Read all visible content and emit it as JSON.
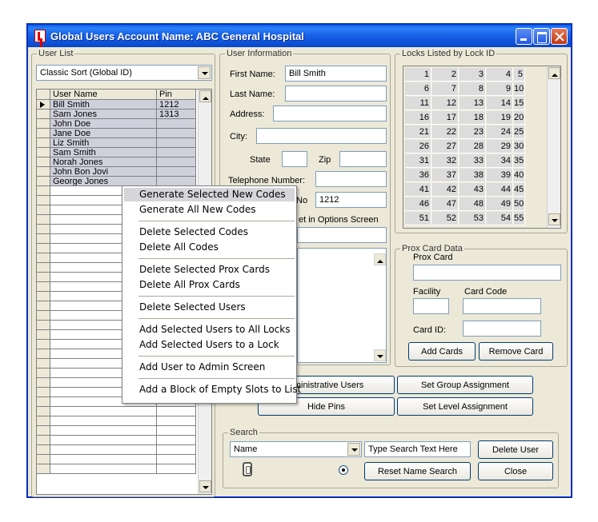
{
  "window": {
    "title": "Global Users Account Name: ABC General Hospital"
  },
  "user_list": {
    "group_label": "User List",
    "sort_select": "Classic Sort (Global ID)",
    "columns": [
      "User Name",
      "Pin"
    ],
    "rows": [
      {
        "name": "Bill Smith",
        "pin": "1212"
      },
      {
        "name": "Sam Jones",
        "pin": "1313"
      },
      {
        "name": "John Doe",
        "pin": ""
      },
      {
        "name": "Jane Doe",
        "pin": ""
      },
      {
        "name": "Liz Smith",
        "pin": ""
      },
      {
        "name": "Sam Smith",
        "pin": ""
      },
      {
        "name": "Norah Jones",
        "pin": ""
      },
      {
        "name": "John Bon Jovi",
        "pin": ""
      },
      {
        "name": "George Jones",
        "pin": ""
      }
    ]
  },
  "user_info": {
    "group_label": "User Information",
    "first_name_label": "First Name:",
    "first_name_value": "Bill Smith",
    "last_name_label": "Last Name:",
    "address_label": "Address:",
    "city_label": "City:",
    "state_label": "State",
    "zip_label": "Zip",
    "telephone_label": "Telephone Number:",
    "pin_partial_label": "No",
    "pin_value": "1212",
    "options_partial": "et in Options Screen"
  },
  "locks": {
    "group_label": "Locks Listed by Lock ID",
    "rows": [
      [
        "1",
        "2",
        "3",
        "4",
        "5"
      ],
      [
        "6",
        "7",
        "8",
        "9",
        "10"
      ],
      [
        "11",
        "12",
        "13",
        "14",
        "15"
      ],
      [
        "16",
        "17",
        "18",
        "19",
        "20"
      ],
      [
        "21",
        "22",
        "23",
        "24",
        "25"
      ],
      [
        "26",
        "27",
        "28",
        "29",
        "30"
      ],
      [
        "31",
        "32",
        "33",
        "34",
        "35"
      ],
      [
        "36",
        "37",
        "38",
        "39",
        "40"
      ],
      [
        "41",
        "42",
        "43",
        "44",
        "45"
      ],
      [
        "46",
        "47",
        "48",
        "49",
        "50"
      ],
      [
        "51",
        "52",
        "53",
        "54",
        "55"
      ]
    ]
  },
  "prox": {
    "group_label": "Prox Card Data",
    "prox_card_label": "Prox Card",
    "facility_label": "Facility",
    "card_code_label": "Card Code",
    "card_id_label": "Card ID:",
    "add_cards": "Add Cards",
    "remove_card": "Remove Card"
  },
  "buttons": {
    "admin_users_partial": "dministrative Users",
    "set_group": "Set Group Assignment",
    "hide_pins": "Hide Pins",
    "set_level": "Set Level Assignment",
    "delete_user": "Delete User",
    "close": "Close"
  },
  "search": {
    "group_label": "Search",
    "field_select": "Name",
    "text_value": "Type Search Text Here",
    "reset": "Reset Name Search"
  },
  "context_menu": {
    "items": [
      "Generate Selected New Codes",
      "Generate All New Codes",
      "Delete Selected Codes",
      "Delete All Codes",
      "Delete Selected Prox Cards",
      "Delete All Prox Cards",
      "Delete Selected Users",
      "Add Selected Users to All Locks",
      "Add Selected Users to a Lock",
      "Add User to Admin Screen",
      "Add a Block of Empty Slots to List"
    ]
  }
}
